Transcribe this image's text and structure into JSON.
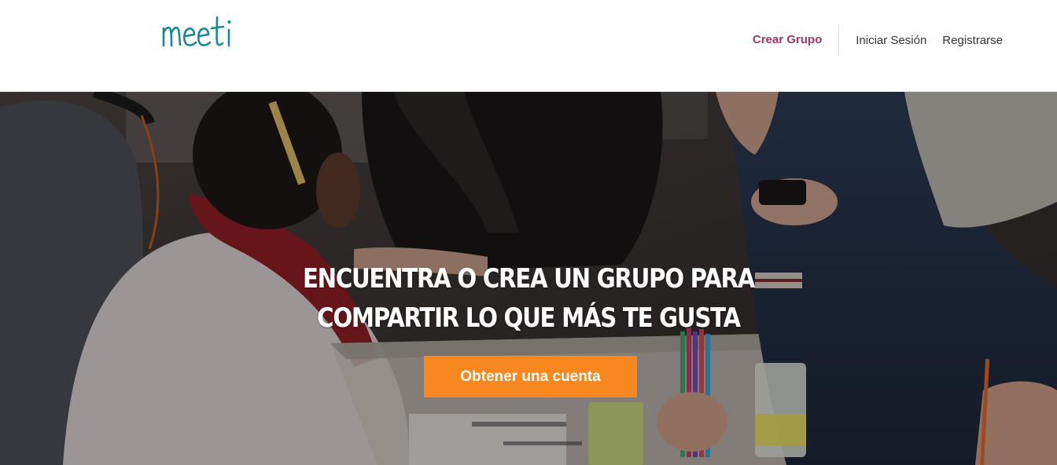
{
  "brand": {
    "logo_text": "meeti",
    "logo_color": "#17889a"
  },
  "nav": {
    "create_group": "Crear Grupo",
    "login": "Iniciar Sesión",
    "register": "Registrarse",
    "accent_color": "#a4365f"
  },
  "hero": {
    "title_line1": "ENCUENTRA O CREA UN GRUPO PARA",
    "title_line2": "COMPARTIR LO QUE MÁS TE GUSTA",
    "cta_label": "Obtener una cuenta",
    "cta_color": "#f7881f",
    "background_image": "people-gathered-studying-photo"
  }
}
